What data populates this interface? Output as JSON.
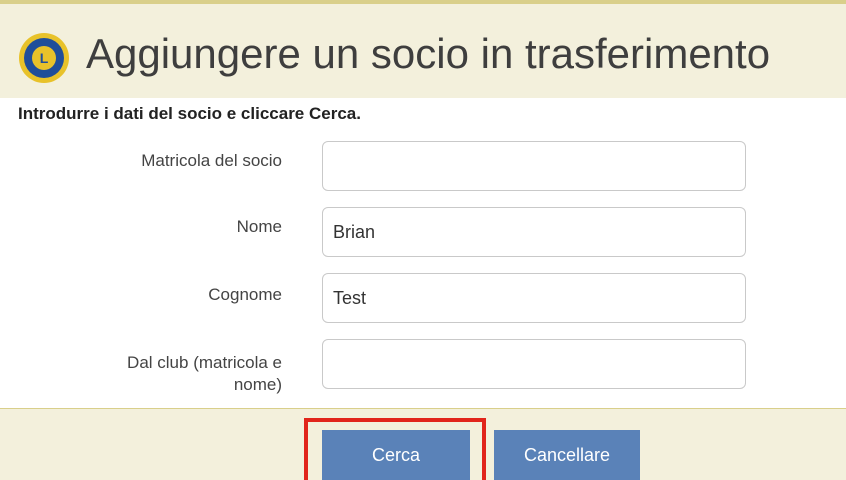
{
  "header": {
    "title": "Aggiungere un socio in trasferimento",
    "logo_icon": "lions-club-logo-icon"
  },
  "instruction": "Introdurre i dati del socio e cliccare Cerca.",
  "form": {
    "member_id": {
      "label": "Matricola del socio",
      "value": ""
    },
    "first_name": {
      "label": "Nome",
      "value": "Brian"
    },
    "last_name": {
      "label": "Cognome",
      "value": "Test"
    },
    "from_club_label_line1": "Dal club (matricola e",
    "from_club_label_line2": "nome)",
    "from_club_value": ""
  },
  "buttons": {
    "search_label": "Cerca",
    "cancel_label": "Cancellare"
  },
  "colors": {
    "header_bg": "#f3f0dc",
    "button_bg": "#5a82b8",
    "highlight": "#e1251b"
  }
}
